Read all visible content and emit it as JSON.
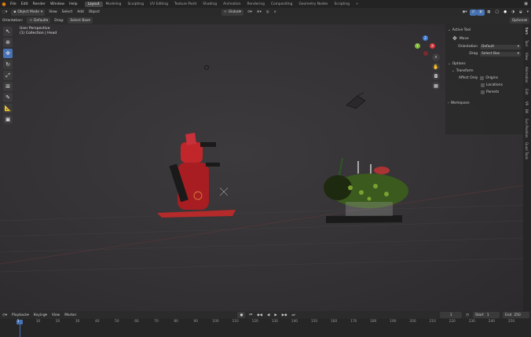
{
  "menu": [
    "File",
    "Edit",
    "Render",
    "Window",
    "Help"
  ],
  "workspaces": [
    "Layout",
    "Modeling",
    "Sculpting",
    "UV Editing",
    "Texture Paint",
    "Shading",
    "Animation",
    "Rendering",
    "Compositing",
    "Geometry Nodes",
    "Scripting",
    "+"
  ],
  "header": {
    "mode": "Object Mode",
    "items": [
      "View",
      "Select",
      "Add",
      "Object"
    ],
    "transform_orientation": "Global",
    "options": "Options"
  },
  "toolsettings": {
    "orientation_label": "Orientation:",
    "orientation_value": "Default",
    "drag_label": "Drag:",
    "drag_value": "Select Box"
  },
  "viewport": {
    "perspective": "User Perspective",
    "collection": "(1) Collection | Head"
  },
  "npanel": {
    "active_tool_title": "Active Tool",
    "tool_name": "Move",
    "orientation_label": "Orientation",
    "orientation_value": "Default",
    "drag_label": "Drag",
    "drag_value": "Select Box",
    "options_title": "Options",
    "transform_title": "Transform",
    "affect_only_label": "Affect Only",
    "affect_items": [
      "Origins",
      "Locations",
      "Parents"
    ],
    "workspace_title": "Workspace"
  },
  "sidetabs": [
    "Item",
    "Tool",
    "View",
    "Animation",
    "Edit",
    "VR",
    "BK",
    "Sun Position",
    "Quad Tools"
  ],
  "gizmo": {
    "x": "X",
    "y": "Y",
    "z": "Z"
  },
  "timeline": {
    "playback": "Playback",
    "keying": "Keying",
    "view": "View",
    "marker": "Marker",
    "current_frame": "1",
    "start_label": "Start",
    "start_value": "1",
    "end_label": "End",
    "end_value": "250"
  },
  "ruler": [
    "1",
    "10",
    "20",
    "30",
    "40",
    "50",
    "60",
    "70",
    "80",
    "90",
    "100",
    "110",
    "120",
    "130",
    "140",
    "150",
    "160",
    "170",
    "180",
    "190",
    "200",
    "210",
    "220",
    "230",
    "240",
    "250"
  ],
  "colors": {
    "accent": "#4772b3",
    "robot_red": "#c0262a",
    "bee_green": "#3a5a1e"
  }
}
